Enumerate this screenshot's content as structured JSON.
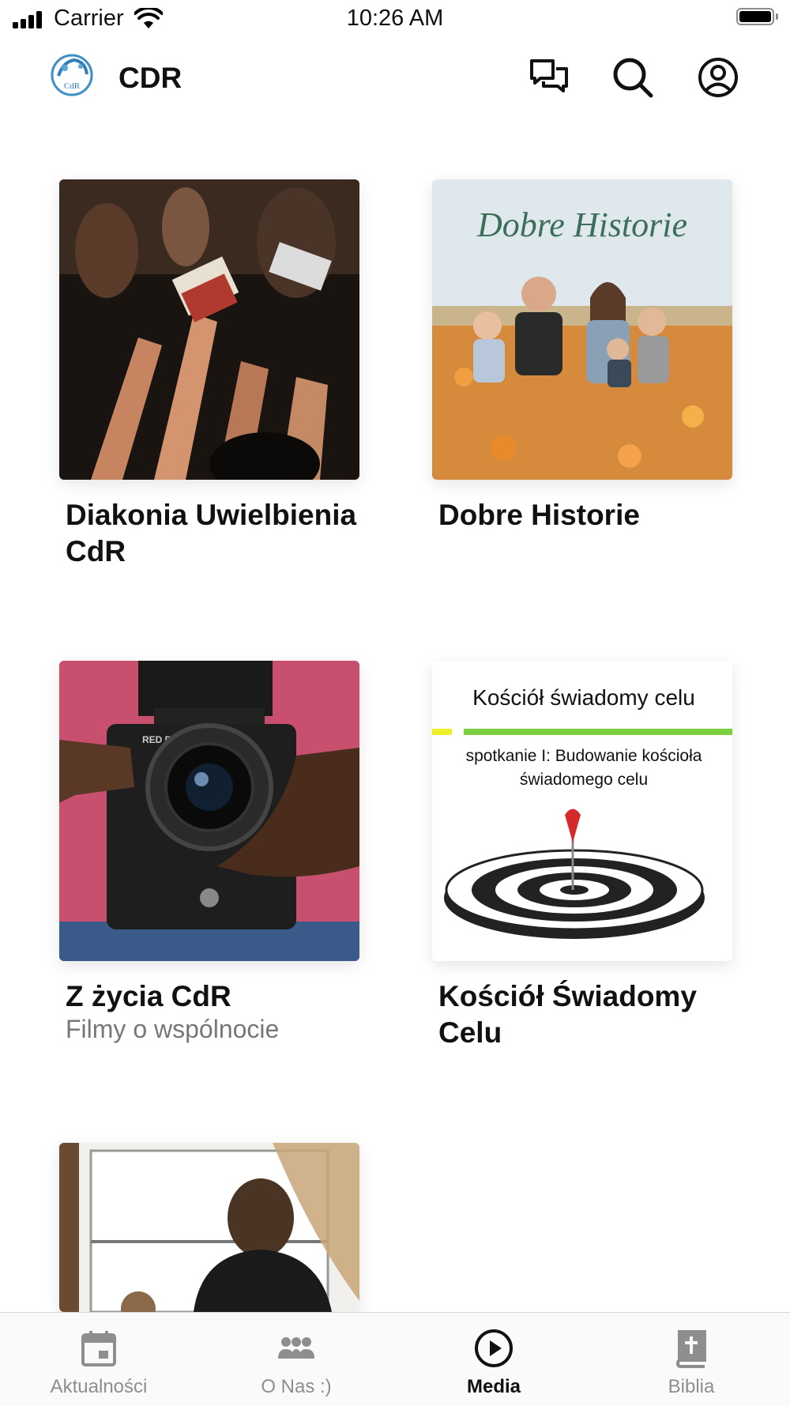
{
  "status_bar": {
    "carrier": "Carrier",
    "time": "10:26 AM"
  },
  "header": {
    "title": "CDR",
    "logo_text": "CdR"
  },
  "cards": [
    {
      "title": "Diakonia Uwielbienia CdR",
      "subtitle": ""
    },
    {
      "title": "Dobre Historie",
      "subtitle": "",
      "image_text": "Dobre Historie"
    },
    {
      "title": "Z życia CdR",
      "subtitle": "Filmy o wspólnocie",
      "image_text": "RED DIGI"
    },
    {
      "title": "Kościół Świadomy Celu",
      "subtitle": "",
      "image_heading": "Kościół świadomy celu",
      "image_line1": "spotkanie I: Budowanie kościoła",
      "image_line2": "świadomego celu"
    },
    {
      "title": "",
      "subtitle": ""
    }
  ],
  "tabs": [
    {
      "label": "Aktualności",
      "icon": "calendar-icon",
      "active": false
    },
    {
      "label": "O Nas :)",
      "icon": "people-icon",
      "active": false
    },
    {
      "label": "Media",
      "icon": "play-circle-icon",
      "active": true
    },
    {
      "label": "Biblia",
      "icon": "bible-icon",
      "active": false
    }
  ],
  "colors": {
    "active_tab": "#111111",
    "inactive_tab": "#8e8e8e",
    "background": "#ffffff"
  }
}
